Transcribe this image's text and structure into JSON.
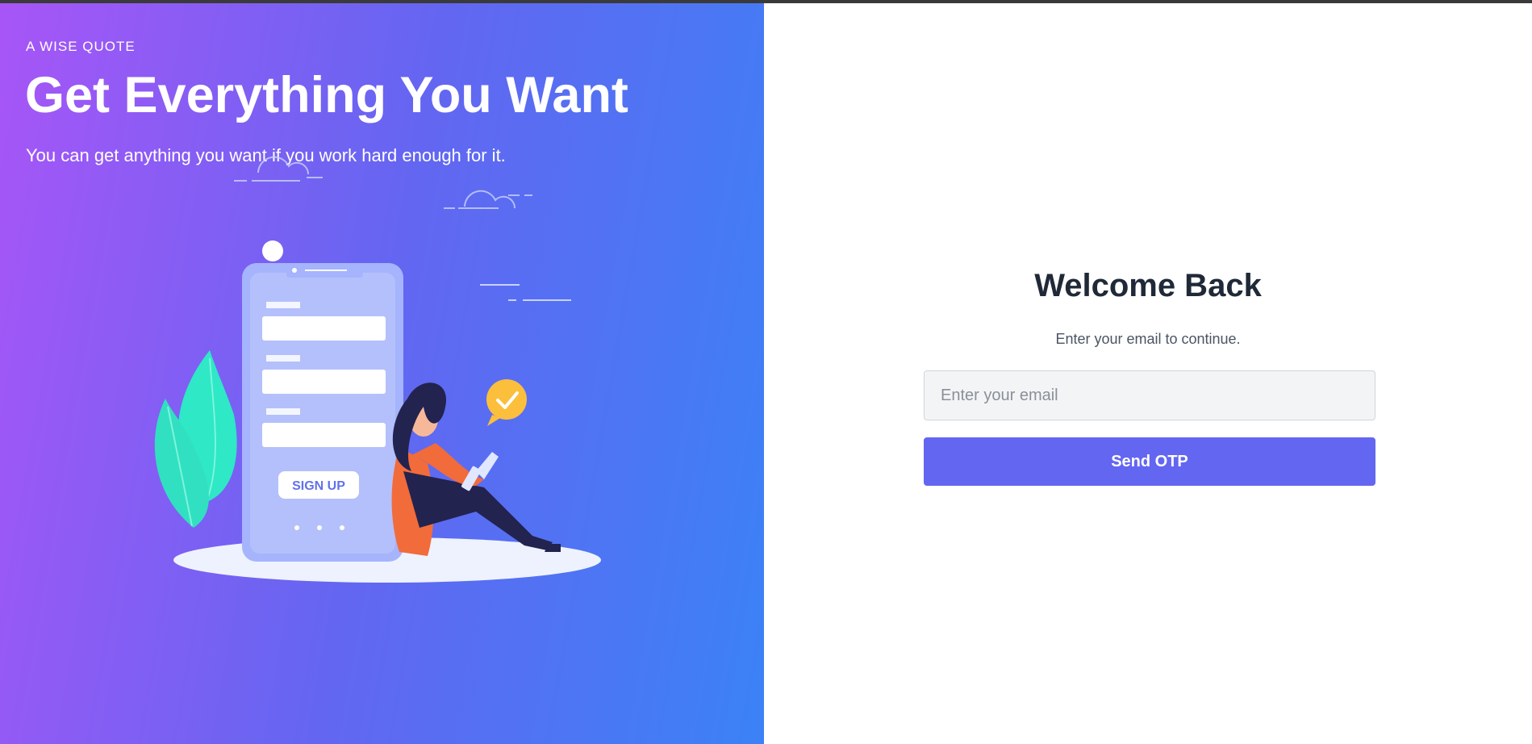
{
  "hero": {
    "eyebrow": "A WISE QUOTE",
    "title": "Get Everything You Want",
    "subtitle": "You can get anything you want if you work hard enough for it.",
    "illustration": {
      "phone_button_label": "SIGN UP"
    }
  },
  "login": {
    "title": "Welcome Back",
    "subtitle": "Enter your email to continue.",
    "email_placeholder": "Enter your email",
    "email_value": "",
    "submit_label": "Send OTP"
  },
  "colors": {
    "gradient_start": "#a855f7",
    "gradient_mid": "#6366f1",
    "gradient_end": "#3b82f6",
    "button_primary": "#6366f1",
    "leaf_accent": "#2ee8c6",
    "shirt_accent": "#f26b3a",
    "badge_accent": "#fbbf3c"
  }
}
